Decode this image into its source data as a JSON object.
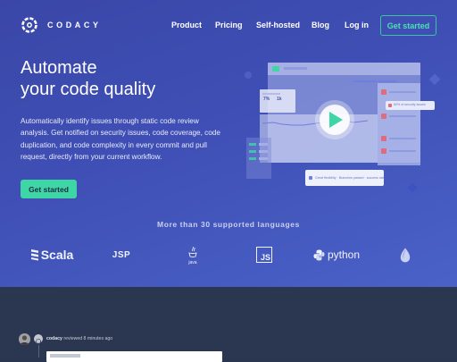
{
  "brand": {
    "name": "CODACY"
  },
  "nav": {
    "links": [
      {
        "label": "Product"
      },
      {
        "label": "Pricing"
      },
      {
        "label": "Self-hosted"
      },
      {
        "label": "Blog"
      },
      {
        "label": "Log in"
      }
    ],
    "cta_label": "Get started"
  },
  "hero": {
    "headline_line1": "Automate",
    "headline_line2": "your code quality",
    "description": "Automatically identify issues through static code review analysis. Get notified on security issues, code coverage, code duplication, and code complexity in every commit and pull request, directly from your current workflow.",
    "cta_label": "Get started"
  },
  "mockup": {
    "metric_1": "7%",
    "metric_2": "1k",
    "security_note": "60% of security issues",
    "notification": "Great flexibility · Branches passed · success rate"
  },
  "languages": {
    "title": "More than 30 supported languages",
    "items": [
      {
        "label": "Scala"
      },
      {
        "label": "JSP"
      },
      {
        "label": "java"
      },
      {
        "label": "JS"
      },
      {
        "label": "python"
      }
    ]
  },
  "activity": {
    "user": "codacy",
    "action": "reviewed 8 minutes ago"
  },
  "colors": {
    "hero_gradient_start": "#3a47a8",
    "hero_gradient_end": "#4a62c8",
    "accent_green": "#3fd6a6",
    "lower_bg": "#2b3650"
  }
}
